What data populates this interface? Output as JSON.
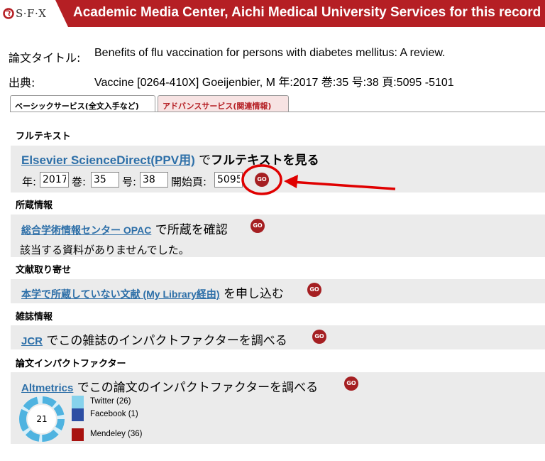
{
  "header": {
    "logo_text": "S·F·X",
    "title": "Academic Media Center, Aichi Medical University Services for this record"
  },
  "record": {
    "title_label": "論文タイトル:",
    "title_value": "Benefits of flu vaccination for persons with diabetes mellitus: A review.",
    "source_label": "出典:",
    "source_value": "Vaccine [0264-410X] Goeijenbier, M 年:2017 巻:35 号:38 頁:5095 -5101"
  },
  "tabs": [
    {
      "label": "ベーシックサービス(全文入手など)"
    },
    {
      "label": "アドバンスサービス(関連情報)"
    }
  ],
  "go_label": "GO",
  "fulltext": {
    "heading": "フルテキスト",
    "link": "Elsevier ScienceDirect(PPV用)",
    "suffix_a": " で",
    "suffix_b": "フルテキストを見る",
    "year_label": "年:",
    "year_value": "2017",
    "volume_label": "巻:",
    "volume_value": "35",
    "issue_label": "号:",
    "issue_value": "38",
    "page_label": "開始頁:",
    "page_value": "5095"
  },
  "holdings": {
    "heading": "所蔵情報",
    "link": "総合学術情報センター OPAC",
    "suffix": " で所蔵を確認",
    "message": "該当する資料がありませんでした。"
  },
  "docdelivery": {
    "heading": "文献取り寄せ",
    "link": "本学で所蔵していない文献 (My Library経由)",
    "suffix": " を申し込む"
  },
  "journal": {
    "heading": "雑誌情報",
    "link": "JCR",
    "suffix": " でこの雑誌のインパクトファクターを調べる"
  },
  "article_impact": {
    "heading": "論文インパクトファクター",
    "link": "Altmetrics",
    "suffix": " でこの論文のインパクトファクターを調べる",
    "score": "21",
    "legend": [
      {
        "label": "Twitter (26)",
        "color": "#86d2ec"
      },
      {
        "label": "Facebook (1)",
        "color": "#2d4ea3"
      },
      {
        "label": "Mendeley (36)",
        "color": "#a8120f"
      }
    ]
  },
  "colors": {
    "brand": "#b51f24",
    "link": "#2d6fa8",
    "annotation": "#e00000"
  }
}
